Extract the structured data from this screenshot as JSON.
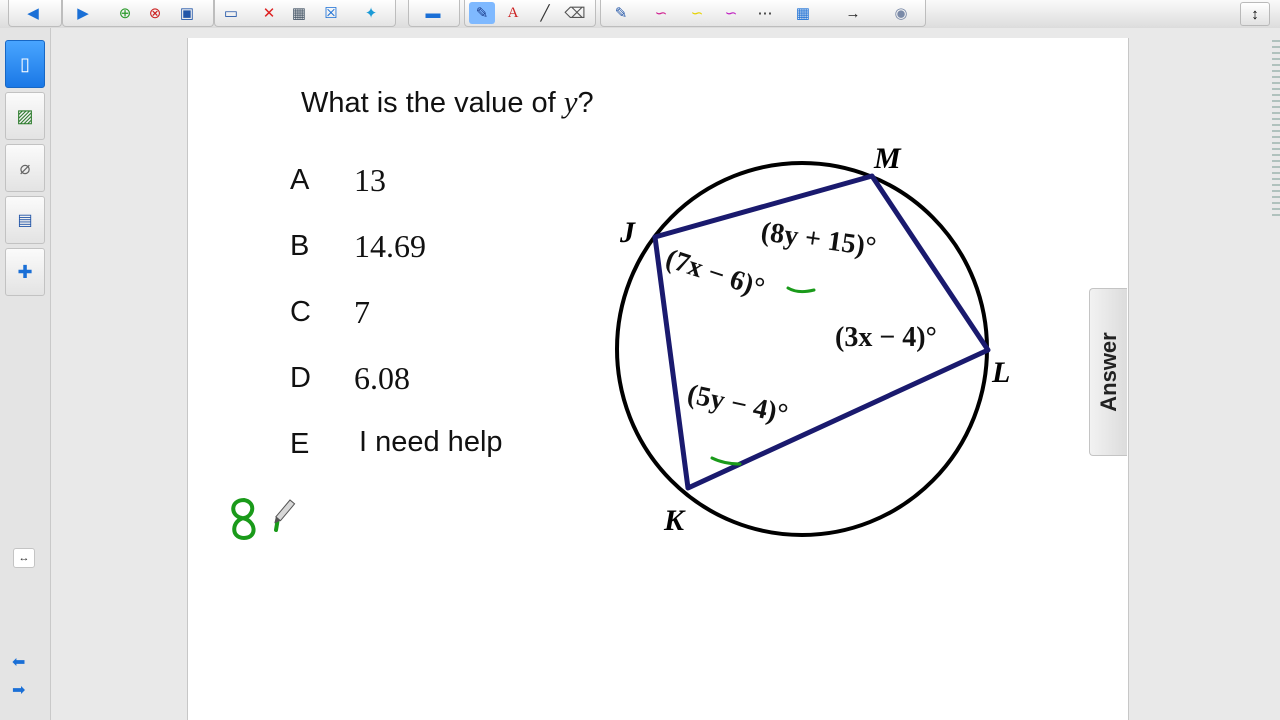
{
  "question": {
    "prefix": "What is the value of ",
    "var": "y",
    "suffix": "?"
  },
  "choices": [
    {
      "letter": "A",
      "value": "13"
    },
    {
      "letter": "B",
      "value": "14.69"
    },
    {
      "letter": "C",
      "value": "7"
    },
    {
      "letter": "D",
      "value": "6.08"
    },
    {
      "letter": "E",
      "value": "I need help"
    }
  ],
  "diagram": {
    "vertices": {
      "J": "J",
      "M": "M",
      "L": "L",
      "K": "K"
    },
    "angles": {
      "J": "(7x − 6)°",
      "M": "(8y + 15)°",
      "L": "(3x − 4)°",
      "K": "(5y − 4)°"
    }
  },
  "handwriting": "8",
  "answer_tab": "Answer",
  "colors": {
    "quad": "#1a1a6e",
    "ink": "#1a9a1a",
    "active_tab": "#1a78e6"
  }
}
